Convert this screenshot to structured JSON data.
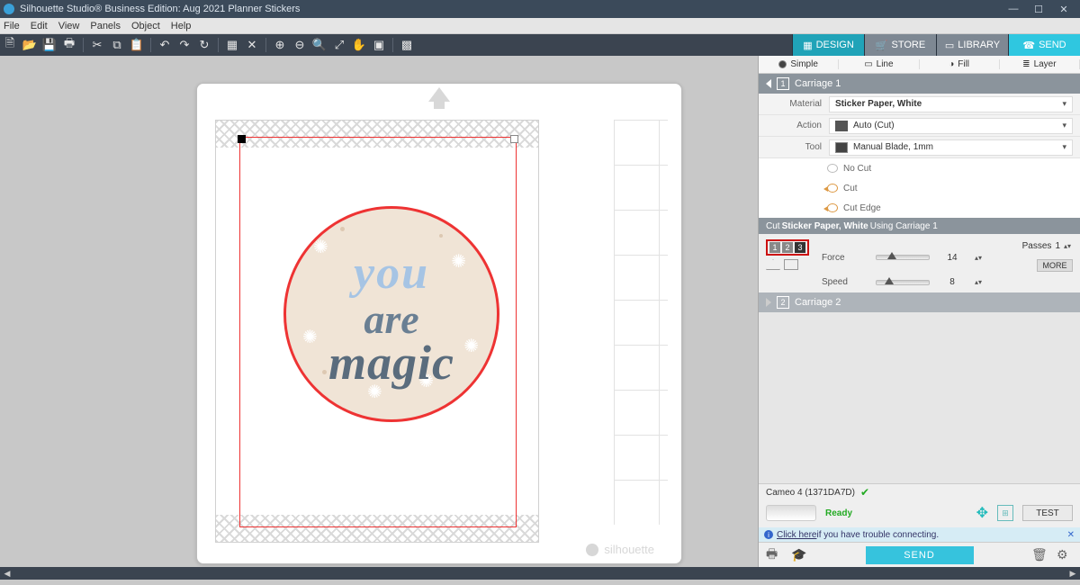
{
  "title": "Silhouette Studio® Business Edition: Aug 2021 Planner Stickers",
  "menu": [
    "File",
    "Edit",
    "View",
    "Panels",
    "Object",
    "Help"
  ],
  "toptabs": {
    "design": "DESIGN",
    "store": "STORE",
    "library": "LIBRARY",
    "send": "SEND"
  },
  "subtabs": {
    "simple": "Simple",
    "line": "Line",
    "fill": "Fill",
    "layer": "Layer"
  },
  "carriage1": "Carriage 1",
  "carriage2": "Carriage 2",
  "settings": {
    "material_lbl": "Material",
    "material_val": "Sticker Paper, White",
    "action_lbl": "Action",
    "action_val": "Auto (Cut)",
    "tool_lbl": "Tool",
    "tool_val": "Manual Blade, 1mm"
  },
  "cutopts": {
    "nocut": "No Cut",
    "cut": "Cut",
    "cutedge": "Cut Edge"
  },
  "banner_prefix": "Cut ",
  "banner_material": "Sticker Paper, White",
  "banner_suffix": " Using Carriage 1",
  "params": {
    "force_lbl": "Force",
    "force_val": "14",
    "speed_lbl": "Speed",
    "speed_val": "8",
    "passes_lbl": "Passes",
    "passes_val": "1",
    "more": "MORE",
    "b1": "1",
    "b2": "2",
    "b3": "3"
  },
  "device": {
    "name": "Cameo 4 (1371DA7D)",
    "status": "Ready",
    "test": "TEST"
  },
  "help": {
    "link": "Click here",
    "rest": " if you have trouble connecting."
  },
  "send_btn": "SEND",
  "watermark": "silhouette",
  "sticker": {
    "t1": "you",
    "t2": "are",
    "t3": "magic"
  }
}
